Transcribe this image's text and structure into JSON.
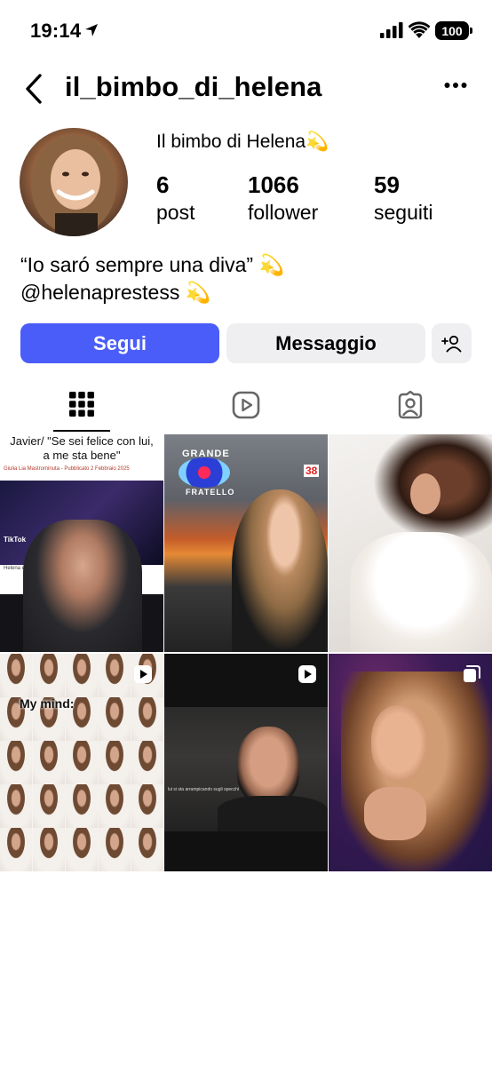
{
  "status_bar": {
    "time": "19:14",
    "battery": "100"
  },
  "nav": {
    "username": "il_bimbo_di_helena"
  },
  "profile": {
    "display_name": "Il bimbo di Helena💫",
    "stats": [
      {
        "value": "6",
        "label": "post"
      },
      {
        "value": "1066",
        "label": "follower"
      },
      {
        "value": "59",
        "label": "seguiti"
      }
    ],
    "bio_line1": "“Io saró sempre una diva”  💫",
    "bio_line2": "@helenaprestess 💫"
  },
  "actions": {
    "follow": "Segui",
    "message": "Messaggio"
  },
  "tabs": [
    "grid-icon",
    "reels-icon",
    "tagged-icon"
  ],
  "posts": {
    "p1_quote": "Javier/ \"Se sei felice con lui, a me sta bene\"",
    "p1_byline": "Giulia Lia Mastrominuta - Pubblicato 2 Febbraio 2025",
    "p1_caption": "Helena e Zeudi al GF (Mediaset Infinity)",
    "p1_tiktok": "TikTok",
    "p2_logo_top": "GRANDE",
    "p2_logo_bottom": "FRATELLO",
    "p2_sign": "38",
    "p4_text": "My mind:",
    "p5_caption": "lui si sta arrampicando sugli specchi"
  },
  "colors": {
    "follow_button": "#4a5df9",
    "secondary_button": "#efeff2"
  }
}
